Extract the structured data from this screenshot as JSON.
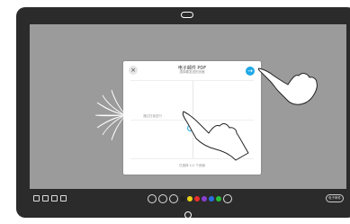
{
  "dialog": {
    "title": "电子邮件 PDF",
    "subtitle": "选择要发送的页面",
    "close_icon": "×",
    "send_icon": "→",
    "page_label": "通过白板进行",
    "footer": "已选择 1/1 个页面"
  },
  "toolbar": {
    "colors": [
      "#222222",
      "#e8d21a",
      "#e8302a",
      "#8a3fd1",
      "#2a6fe0",
      "#2bbf3a"
    ]
  },
  "bottom_right": {
    "label": "电子邮件"
  },
  "colors": {
    "accent": "#1ea8e6",
    "screen": "#9b9b9b",
    "bezel": "#2b2b2b"
  }
}
